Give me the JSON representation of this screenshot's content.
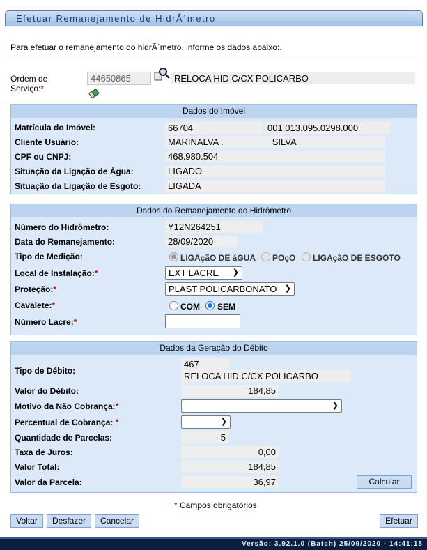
{
  "title": "Efetuar Remanejamento de HidrÃ´metro",
  "intro": "Para efetuar o remanejamento do hidrÃ´metro, informe os dados abaixo:.",
  "ordem": {
    "label": "Ordem de Serviço:",
    "req": "*",
    "value": "44650865",
    "description": "RELOCA HID C/CX POLICARBO"
  },
  "imovel": {
    "header": "Dados do Imóvel",
    "matricula_label": "Matrícula do Imóvel:",
    "matricula_value": "66704",
    "matricula_code": "001.013.095.0298.000",
    "cliente_label": "Cliente Usuário:",
    "cliente_first": "MARINALVA .",
    "cliente_last": "SILVA",
    "cpf_label": "CPF ou CNPJ:",
    "cpf_value": "468.980.504",
    "agua_label": "Situação da Ligação de Água:",
    "agua_value": "LIGADO",
    "esgoto_label": "Situação da Ligação de Esgoto:",
    "esgoto_value": "LIGADA"
  },
  "remanejamento": {
    "header": "Dados do Remanejamento do Hidrômetro",
    "numero_label": "Número do Hidrômetro:",
    "numero_value": "Y12N264251",
    "data_label": "Data do Remanejamento:",
    "data_value": "28/09/2020",
    "tipo_label": "Tipo de Medição:",
    "tipo_options": [
      "LIGAçãO DE áGUA",
      "POçO",
      "LIGAçãO DE ESGOTO"
    ],
    "local_label": "Local de Instalação:",
    "local_value": "EXT LACRE",
    "protecao_label": "Proteção:",
    "protecao_value": "PLAST POLICARBONATO",
    "cavalete_label": "Cavalete:",
    "cavalete_com": "COM",
    "cavalete_sem": "SEM",
    "lacre_label": "Número Lacre:",
    "req": "*"
  },
  "debito": {
    "header": "Dados da Geração do Débito",
    "tipo_label": "Tipo de Débito:",
    "tipo_code": "467",
    "tipo_desc": "RELOCA HID C/CX POLICARBO",
    "valor_label": "Valor do Débito:",
    "valor_value": "184,85",
    "motivo_label": "Motivo da Não Cobrança:",
    "percentual_label": "Percentual de Cobrança:",
    "parcelas_label": "Quantidade de Parcelas:",
    "parcelas_value": "5",
    "juros_label": "Taxa de Juros:",
    "juros_value": "0,00",
    "total_label": "Valor Total:",
    "total_value": "184,85",
    "parcela_label": "Valor da Parcela:",
    "parcela_value": "36,97",
    "calcular": "Calcular",
    "req": "*"
  },
  "required_note": "Campos obrigatórios",
  "required_star": "*",
  "buttons": {
    "voltar": "Voltar",
    "desfazer": "Desfazer",
    "cancelar": "Cancelar",
    "efetuar": "Efetuar"
  },
  "version": "Versão: 3.92.1.0 (Batch) 25/09/2020 - 14:41:18",
  "colors": {
    "section_bg": "#dce9f8",
    "section_header": "#bcd4ef",
    "footer": "#0c1e40",
    "required": "#cc0000",
    "radio_selected": "#1a73e8"
  }
}
